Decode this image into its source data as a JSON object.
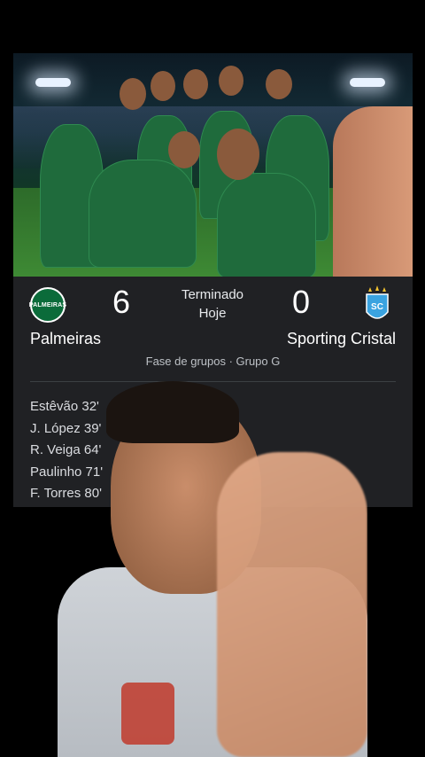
{
  "match": {
    "status_line1": "Terminado",
    "status_line2": "Hoje",
    "stage": "Fase de grupos · Grupo G",
    "home": {
      "name": "Palmeiras",
      "score": "6",
      "logo_text": "PALMEIRAS",
      "color": "#0b6b3a"
    },
    "away": {
      "name": "Sporting Cristal",
      "score": "0",
      "logo_text": "SC",
      "color": "#3aa3e0"
    },
    "scorers": [
      "Estêvão 32'",
      "J. López 39'",
      "R. Veiga 64'",
      "Paulinho 71'",
      "F. Torres 80'"
    ]
  },
  "colors": {
    "card_bg": "#202124",
    "page_bg": "#000000"
  },
  "icons": {
    "home_logo": "palmeiras-crest-icon",
    "away_logo": "sporting-cristal-crest-icon"
  }
}
